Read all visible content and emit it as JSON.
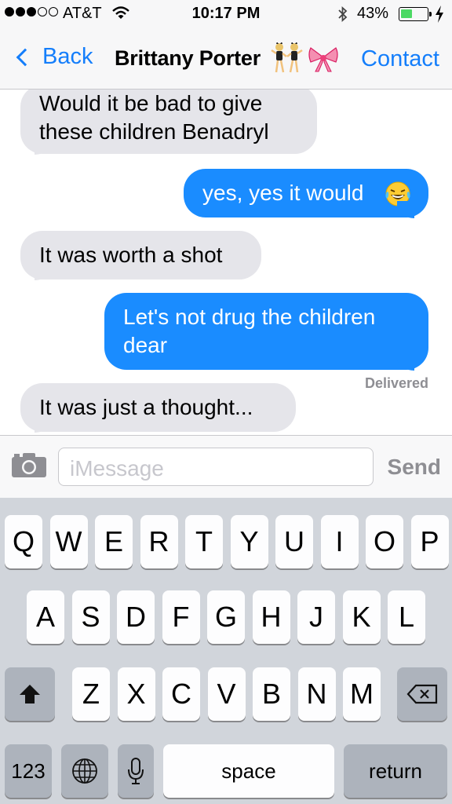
{
  "status_bar": {
    "carrier": "AT&T",
    "time": "10:17 PM",
    "battery_percent": "43%",
    "battery_level": 0.43,
    "signal_bars_filled": 3,
    "signal_bars_total": 5
  },
  "nav": {
    "back_label": "Back",
    "title": "Brittany Porter",
    "contact_label": "Contact",
    "title_emojis": [
      "dancers-emoji",
      "ribbon-bow-emoji"
    ]
  },
  "messages": [
    {
      "direction": "incoming",
      "text": "Would it be bad to give these children Benadryl"
    },
    {
      "direction": "outgoing",
      "text": "yes, yes it would",
      "emoji": "laughing-tears-emoji"
    },
    {
      "direction": "incoming",
      "text": "It was worth a shot"
    },
    {
      "direction": "outgoing",
      "text": "Let's not drug the children dear"
    },
    {
      "direction": "incoming",
      "text": "It was just a thought..."
    }
  ],
  "delivered_label": "Delivered",
  "composer": {
    "placeholder": "iMessage",
    "send_label": "Send"
  },
  "keyboard": {
    "row1": [
      "Q",
      "W",
      "E",
      "R",
      "T",
      "Y",
      "U",
      "I",
      "O",
      "P"
    ],
    "row2": [
      "A",
      "S",
      "D",
      "F",
      "G",
      "H",
      "J",
      "K",
      "L"
    ],
    "row3": [
      "Z",
      "X",
      "C",
      "V",
      "B",
      "N",
      "M"
    ],
    "numbers_label": "123",
    "space_label": "space",
    "return_label": "return"
  },
  "colors": {
    "accent": "#147efb",
    "outgoing_bubble": "#1a8cff",
    "incoming_bubble": "#e5e5ea",
    "battery_fill": "#4cd964"
  }
}
